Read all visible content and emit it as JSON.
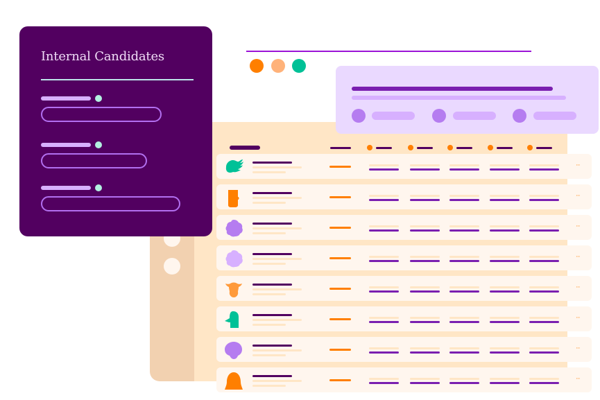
{
  "card": {
    "title": "Internal Candidates",
    "fields": [
      {
        "label": "",
        "status": "active"
      },
      {
        "label": "",
        "status": "active"
      },
      {
        "label": "",
        "status": "active"
      }
    ]
  },
  "window_controls": [
    {
      "name": "close",
      "color": "#ff7f00"
    },
    {
      "name": "minimize",
      "color": "#ffb27a"
    },
    {
      "name": "maximize",
      "color": "#00c197"
    }
  ],
  "popup": {
    "items": [
      {
        "icon": "circle"
      },
      {
        "icon": "circle"
      },
      {
        "icon": "circle"
      }
    ]
  },
  "table": {
    "columns": 5,
    "rows": [
      {
        "avatar": "bird-icon",
        "color": "#00c197",
        "more": "···"
      },
      {
        "avatar": "cup-icon",
        "color": "#ff7f00",
        "more": "···"
      },
      {
        "avatar": "cloud-icon",
        "color": "#b57cf0",
        "more": "···"
      },
      {
        "avatar": "cloud-icon",
        "color": "#d7b0ff",
        "more": "···"
      },
      {
        "avatar": "cow-icon",
        "color": "#ff9a3a",
        "more": "···"
      },
      {
        "avatar": "profile-icon",
        "color": "#00c197",
        "more": "···"
      },
      {
        "avatar": "head-icon",
        "color": "#b57cf0",
        "more": "···"
      },
      {
        "avatar": "bell-icon",
        "color": "#ff7f00",
        "more": "···"
      }
    ]
  },
  "colors": {
    "brand_purple": "#520060",
    "accent_orange": "#ff7f00",
    "accent_teal": "#00c197",
    "lilac": "#ead9ff",
    "tan": "#ffe6c6"
  }
}
